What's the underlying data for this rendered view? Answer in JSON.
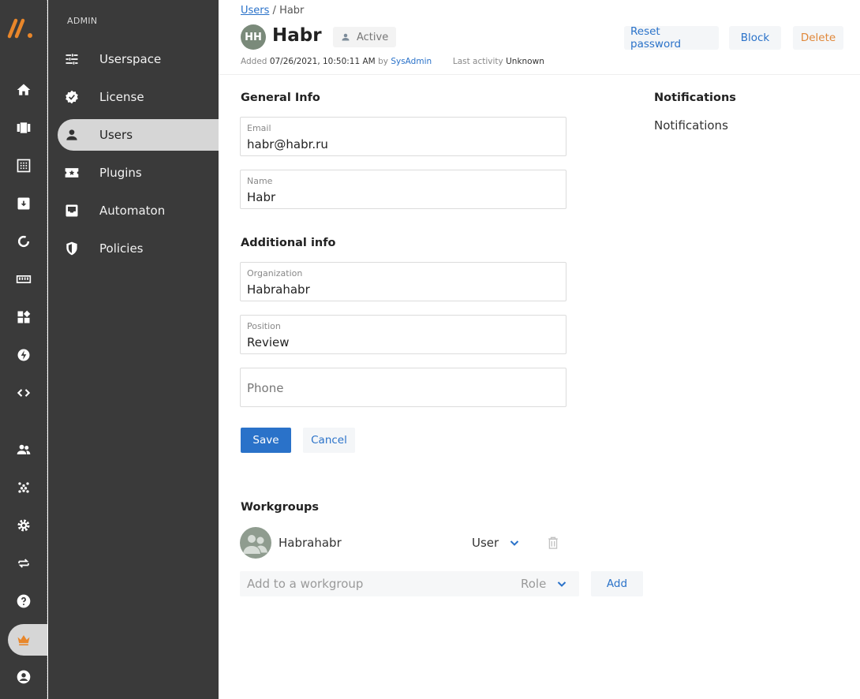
{
  "rail": {
    "items": [
      "home",
      "board",
      "calendar",
      "archive",
      "refresh",
      "ruler",
      "widgets",
      "bolt",
      "code",
      "people",
      "dots",
      "settings",
      "sync",
      "help",
      "admin-crown",
      "account"
    ]
  },
  "sidebar": {
    "heading": "ADMIN",
    "items": [
      {
        "label": "Userspace",
        "icon": "sliders-icon"
      },
      {
        "label": "License",
        "icon": "verified-badge-icon"
      },
      {
        "label": "Users",
        "icon": "person-icon",
        "active": true
      },
      {
        "label": "Plugins",
        "icon": "ticket-icon"
      },
      {
        "label": "Automaton",
        "icon": "inbox-icon"
      },
      {
        "label": "Policies",
        "icon": "shield-icon"
      }
    ]
  },
  "header": {
    "breadcrumb_link": "Users",
    "breadcrumb_sep": " / ",
    "breadcrumb_current": "Habr",
    "avatar_initials": "HH",
    "title": "Habr",
    "status": "Active",
    "added_label": "Added",
    "added_value": "07/26/2021, 10:50:11 AM",
    "by_label": "by",
    "added_by": "SysAdmin",
    "last_activity_label": "Last activity",
    "last_activity_value": "Unknown",
    "reset_password": "Reset password",
    "block": "Block",
    "delete": "Delete"
  },
  "general": {
    "title": "General Info",
    "email_label": "Email",
    "email_value": "habr@habr.ru",
    "name_label": "Name",
    "name_value": "Habr"
  },
  "additional": {
    "title": "Additional info",
    "org_label": "Organization",
    "org_value": "Habrahabr",
    "position_label": "Position",
    "position_value": "Review",
    "phone_placeholder": "Phone"
  },
  "actions": {
    "save": "Save",
    "cancel": "Cancel"
  },
  "notifications": {
    "title": "Notifications",
    "text": "Notifications"
  },
  "workgroups": {
    "title": "Workgroups",
    "items": [
      {
        "name": "Habrahabr",
        "role": "User"
      }
    ],
    "add_placeholder": "Add to a workgroup",
    "role_placeholder": "Role",
    "add_button": "Add"
  },
  "colors": {
    "accent": "#2a72c9",
    "danger": "#e0883a",
    "brand": "#e8862a",
    "sidebar_bg": "#3a3a3a"
  }
}
